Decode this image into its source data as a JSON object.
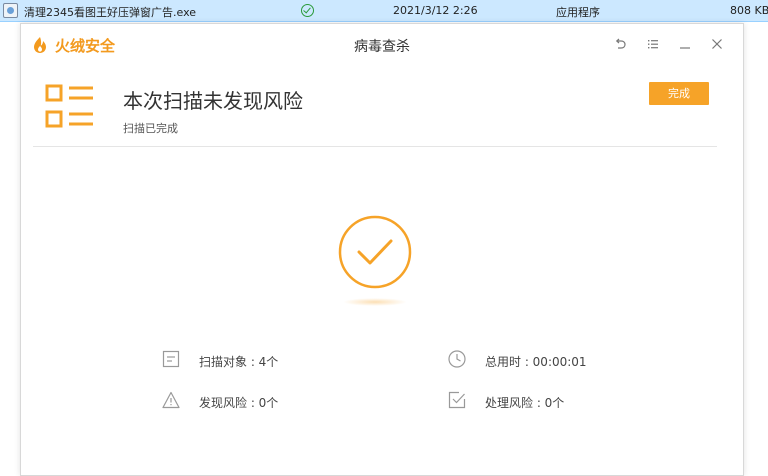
{
  "file_row": {
    "name": "清理2345看图王好压弹窗广告.exe",
    "date": "2021/3/12 2:26",
    "type": "应用程序",
    "size": "808 KB"
  },
  "dialog": {
    "brand": "火绒安全",
    "title": "病毒查杀",
    "result_title": "本次扫描未发现风险",
    "result_subtitle": "扫描已完成",
    "done_label": "完成",
    "stats": {
      "scan_objects": "扫描对象 : 4个",
      "total_time": "总用时 : 00:00:01",
      "risks_found": "发现风险 : 0个",
      "risks_handled": "处理风险 : 0个"
    }
  },
  "colors": {
    "accent": "#f6a328",
    "selection": "#cce8ff"
  },
  "icons": [
    "file-exe-icon",
    "sync-ok-icon",
    "flame-logo-icon",
    "back-icon",
    "menu-icon",
    "minimize-icon",
    "close-icon",
    "list-report-icon",
    "check-circle-icon",
    "document-icon",
    "clock-icon",
    "warning-icon",
    "checkbox-icon"
  ]
}
